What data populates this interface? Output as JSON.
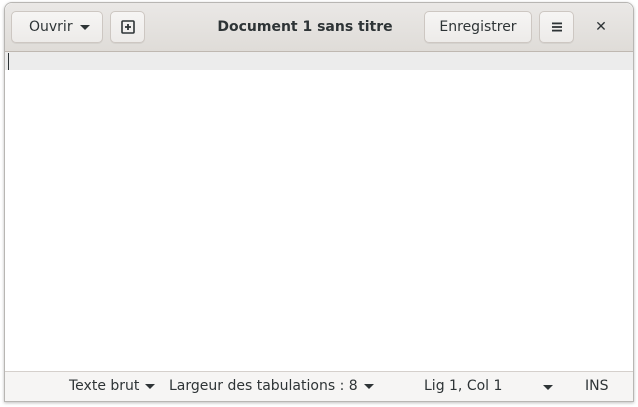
{
  "header": {
    "open_label": "Ouvrir",
    "title": "Document 1 sans titre",
    "save_label": "Enregistrer",
    "new_tab_icon": "new-document-icon",
    "menu_icon": "hamburger-menu-icon",
    "close_glyph": "✕"
  },
  "statusbar": {
    "language": "Texte brut",
    "tab_width": "Largeur des tabulations : 8",
    "position": "Lig 1, Col 1",
    "insert_mode": "INS"
  },
  "editor": {
    "content": ""
  }
}
